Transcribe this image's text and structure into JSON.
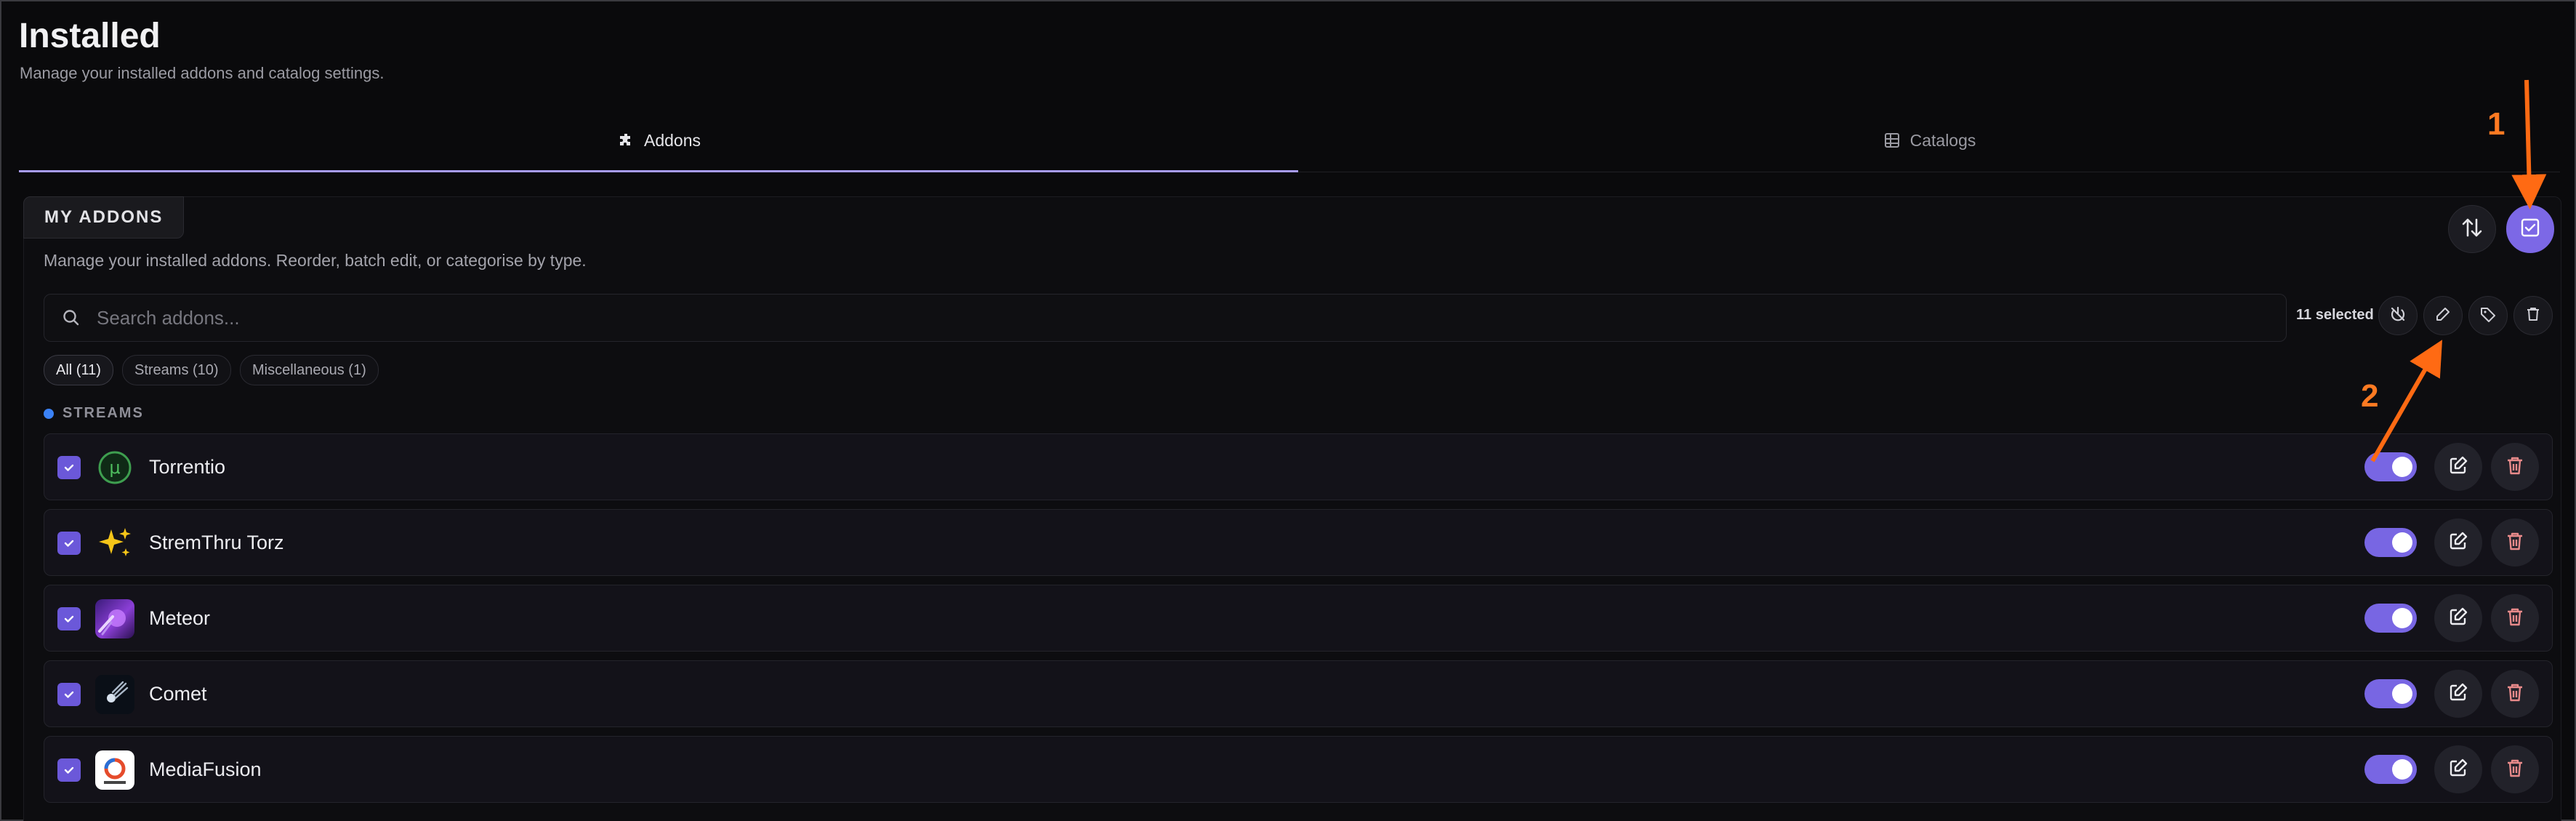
{
  "page": {
    "title": "Installed",
    "subtitle": "Manage your installed addons and catalog settings."
  },
  "tabs": [
    {
      "label": "Addons",
      "icon": "puzzle-icon",
      "active": true
    },
    {
      "label": "Catalogs",
      "icon": "grid-icon",
      "active": false
    }
  ],
  "panel": {
    "label": "MY ADDONS",
    "description": "Manage your installed addons. Reorder, batch edit, or categorise by type.",
    "sort_icon": "sort-arrows-icon",
    "select_mode_icon": "checkbox-select-icon"
  },
  "search": {
    "placeholder": "Search addons...",
    "value": ""
  },
  "selection": {
    "count_label": "11 selected",
    "actions": [
      "disable-icon",
      "pencil-icon",
      "tag-icon",
      "trash-icon"
    ]
  },
  "filters": [
    {
      "label": "All (11)",
      "active": true
    },
    {
      "label": "Streams (10)",
      "active": false
    },
    {
      "label": "Miscellaneous (1)",
      "active": false
    }
  ],
  "section": {
    "label": "STREAMS",
    "color": "#3b82f6"
  },
  "addons": [
    {
      "name": "Torrentio",
      "logo": "utorrent-mu-icon",
      "checked": true,
      "enabled": true
    },
    {
      "name": "StremThru Torz",
      "logo": "sparkles-icon",
      "checked": true,
      "enabled": true
    },
    {
      "name": "Meteor",
      "logo": "meteor-logo-icon",
      "checked": true,
      "enabled": true
    },
    {
      "name": "Comet",
      "logo": "comet-logo-icon",
      "checked": true,
      "enabled": true
    },
    {
      "name": "MediaFusion",
      "logo": "mediafusion-logo-icon",
      "checked": true,
      "enabled": true
    }
  ],
  "annotations": [
    {
      "label": "1"
    },
    {
      "label": "2"
    }
  ],
  "colors": {
    "accent": "#7c68e6",
    "annotation": "#ff7a22",
    "delete": "#e88a8a"
  }
}
